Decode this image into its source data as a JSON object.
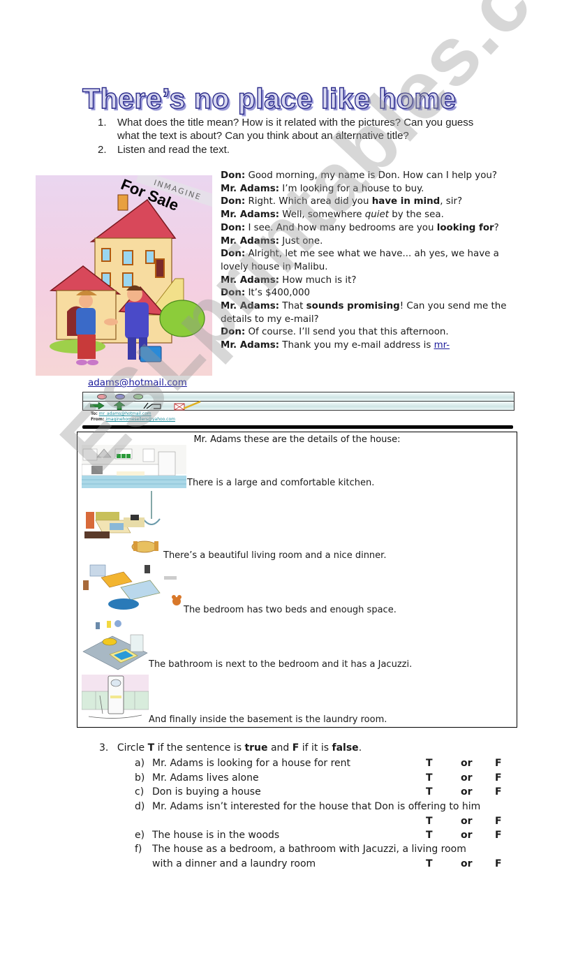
{
  "title": "There’s no place like home",
  "questions": [
    {
      "number": "1.",
      "text": "What does the title mean? How is it related with the pictures? Can you guess what the text is about? Can you think about an alternative title?"
    },
    {
      "number": "2.",
      "text": "Listen and read the text."
    }
  ],
  "picture": {
    "description": "Cartoon of a house for sale with a real-estate agent shaking hands with a customer",
    "brand_label": "INMAGINE",
    "sign_text": "For Sale"
  },
  "dialogue": [
    {
      "speaker": "Don:",
      "parts": [
        {
          "t": " Good morning, my name is Don. How can I help you?"
        }
      ]
    },
    {
      "speaker": "Mr. Adams:",
      "parts": [
        {
          "t": " I’m looking for a house to buy."
        }
      ]
    },
    {
      "speaker": "Don:",
      "parts": [
        {
          "t": " Right. Which area did you "
        },
        {
          "t": "have in mind",
          "b": true
        },
        {
          "t": ", sir?"
        }
      ]
    },
    {
      "speaker": "Mr. Adams:",
      "parts": [
        {
          "t": " Well, somewhere "
        },
        {
          "t": "quiet",
          "i": true
        },
        {
          "t": " by the sea."
        }
      ]
    },
    {
      "speaker": "Don:",
      "parts": [
        {
          "t": " I see. And how many bedrooms are you "
        },
        {
          "t": "looking for",
          "b": true
        },
        {
          "t": "?"
        }
      ]
    },
    {
      "speaker": "Mr. Adams:",
      "parts": [
        {
          "t": " Just one."
        }
      ]
    },
    {
      "speaker": "Don:",
      "parts": [
        {
          "t": " Alright, let me see what we have... ah yes, we have a lovely house in Malibu."
        }
      ]
    },
    {
      "speaker": "Mr. Adams:",
      "parts": [
        {
          "t": " How much is it?"
        }
      ]
    },
    {
      "speaker": "Don:",
      "parts": [
        {
          "t": " It’s $400,000"
        }
      ]
    },
    {
      "speaker": "Mr. Adams:",
      "parts": [
        {
          "t": " That "
        },
        {
          "t": "sounds promising",
          "b": true
        },
        {
          "t": "! Can you send me the details to my e-mail?"
        }
      ]
    },
    {
      "speaker": "Don:",
      "parts": [
        {
          "t": " Of course. I’ll send you that this afternoon."
        }
      ]
    },
    {
      "speaker": "Mr. Adams:",
      "parts": [
        {
          "t": " Thank you my e-mail address is "
        },
        {
          "t": "mr-",
          "link": true
        }
      ]
    }
  ],
  "email_continuation": "adams@hotmail.com",
  "email_window": {
    "to_label": "To:",
    "to_value": "mr_adams@hotmail.com",
    "from_label": "From:",
    "from_value": "imaginehomesellers@yahoo.com",
    "dot_colors": [
      "#e89aa0",
      "#8d8fd0",
      "#9fd49a"
    ]
  },
  "details": {
    "heading": "Mr. Adams these are the details of the house:",
    "rooms": [
      {
        "name": "kitchen",
        "text": "There is a large and comfortable kitchen."
      },
      {
        "name": "living-room",
        "text": "There’s a beautiful living room and a nice dinner."
      },
      {
        "name": "bedroom",
        "text": "The bedroom has two beds and enough space."
      },
      {
        "name": "bathroom",
        "text": "The bathroom is next to the bedroom and it has a Jacuzzi."
      },
      {
        "name": "laundry",
        "text": "And finally inside the basement is the laundry room."
      }
    ]
  },
  "exercise3": {
    "number": "3.",
    "instruction_parts": [
      {
        "t": "Circle "
      },
      {
        "t": "T",
        "b": true
      },
      {
        "t": " if the sentence is "
      },
      {
        "t": "true",
        "b": true
      },
      {
        "t": " and "
      },
      {
        "t": "F",
        "b": true
      },
      {
        "t": " if it is "
      },
      {
        "t": "false",
        "b": true
      },
      {
        "t": "."
      }
    ],
    "options": {
      "t": "T",
      "or": "or",
      "f": "F"
    },
    "items": [
      {
        "letter": "a)",
        "text": "Mr. Adams is looking for a house for rent"
      },
      {
        "letter": "b)",
        "text": "Mr. Adams lives alone"
      },
      {
        "letter": "c)",
        "text": "Don is buying a house"
      },
      {
        "letter": "d)",
        "text": "Mr. Adams isn’t interested for the house that Don is offering to him"
      },
      {
        "letter": "e)",
        "text": "The house is in the woods"
      },
      {
        "letter": "f)",
        "text": "The house as a bedroom, a bathroom with Jacuzzi, a living room with a dinner and a laundry room"
      }
    ]
  },
  "watermark": "ESLprintables.com"
}
